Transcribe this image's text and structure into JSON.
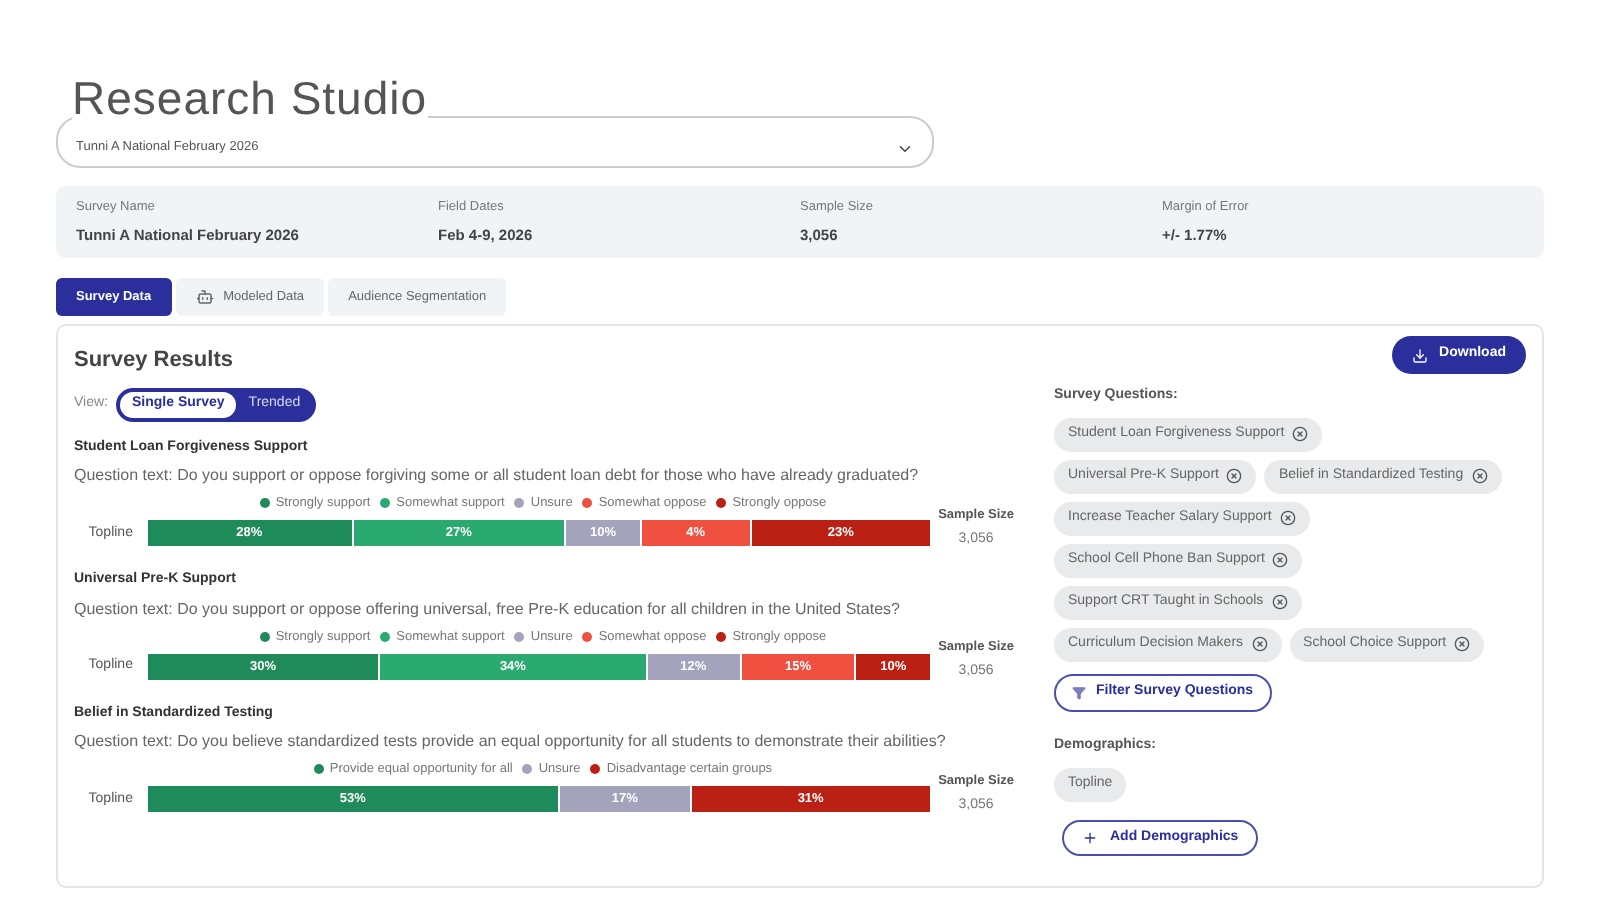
{
  "app_title": "Research Studio",
  "survey_select": {
    "value": "Tunni A National February 2026"
  },
  "summary": [
    {
      "label": "Survey Name",
      "value": "Tunni A National February 2026"
    },
    {
      "label": "Field Dates",
      "value": "Feb 4-9, 2026"
    },
    {
      "label": "Sample Size",
      "value": "3,056"
    },
    {
      "label": "Margin of Error",
      "value": "+/- 1.77%"
    }
  ],
  "tabs": [
    {
      "label": "Survey Data",
      "selected": true,
      "icon": false
    },
    {
      "label": "Modeled Data",
      "selected": false,
      "icon": true
    },
    {
      "label": "Audience Segmentation",
      "selected": false,
      "icon": false
    }
  ],
  "results": {
    "title": "Survey Results",
    "view_label": "View:",
    "view_options": [
      {
        "label": "Single Survey",
        "selected": true
      },
      {
        "label": "Trended",
        "selected": false
      }
    ],
    "questions": [
      {
        "title": "Student Loan Forgiveness Support",
        "text": "Question text: Do you support or oppose forgiving some or all student loan debt for those who have already graduated?",
        "row_label": "Topline",
        "sample_label": "Sample Size",
        "sample_value": "3,056",
        "legend": [
          {
            "label": "Strongly support",
            "color": "#1f8a5a"
          },
          {
            "label": "Somewhat support",
            "color": "#2aaa6e"
          },
          {
            "label": "Unsure",
            "color": "#a3a3bb"
          },
          {
            "label": "Somewhat oppose",
            "color": "#ef5040"
          },
          {
            "label": "Strongly oppose",
            "color": "#bb2015"
          }
        ],
        "segments": [
          {
            "label": "28%",
            "color": "#1f8a5a"
          },
          {
            "label": "27%",
            "color": "#2aaa6e"
          },
          {
            "label": "10%",
            "color": "#a3a3bb"
          },
          {
            "label": "4%",
            "color": "#ef5040"
          },
          {
            "label": "23%",
            "color": "#bb2015"
          }
        ]
      },
      {
        "title": "Universal Pre-K Support",
        "text": "Question text: Do you support or oppose offering universal, free Pre-K education for all children in the United States?",
        "row_label": "Topline",
        "sample_label": "Sample Size",
        "sample_value": "3,056",
        "legend": [
          {
            "label": "Strongly support",
            "color": "#1f8a5a"
          },
          {
            "label": "Somewhat support",
            "color": "#2aaa6e"
          },
          {
            "label": "Unsure",
            "color": "#a3a3bb"
          },
          {
            "label": "Somewhat oppose",
            "color": "#ef5040"
          },
          {
            "label": "Strongly oppose",
            "color": "#bb2015"
          }
        ],
        "segments": [
          {
            "label": "30%",
            "color": "#1f8a5a"
          },
          {
            "label": "34%",
            "color": "#2aaa6e"
          },
          {
            "label": "12%",
            "color": "#a3a3bb"
          },
          {
            "label": "15%",
            "color": "#ef5040"
          },
          {
            "label": "10%",
            "color": "#bb2015"
          }
        ]
      },
      {
        "title": "Belief in Standardized Testing",
        "text": "Question text: Do you believe standardized tests provide an equal opportunity for all students to demonstrate their abilities?",
        "row_label": "Topline",
        "sample_label": "Sample Size",
        "sample_value": "3,056",
        "legend": [
          {
            "label": "Provide equal opportunity for all",
            "color": "#1f8a5a"
          },
          {
            "label": "Unsure",
            "color": "#a3a3bb"
          },
          {
            "label": "Disadvantage certain groups",
            "color": "#bb2015"
          }
        ],
        "segments": [
          {
            "label": "53%",
            "color": "#1f8a5a"
          },
          {
            "label": "17%",
            "color": "#a3a3bb"
          },
          {
            "label": "31%",
            "color": "#bb2015"
          }
        ]
      }
    ]
  },
  "sidebar": {
    "download": "Download",
    "questions_title": "Survey Questions:",
    "question_chips": [
      [
        "Student Loan Forgiveness Support"
      ],
      [
        "Universal Pre-K Support",
        "Belief in Standardized Testing"
      ],
      [
        "Increase Teacher Salary Support"
      ],
      [
        "School Cell Phone Ban Support"
      ],
      [
        "Support CRT Taught in Schools"
      ],
      [
        "Curriculum Decision Makers",
        "School Choice Support"
      ]
    ],
    "filter_button": "Filter Survey Questions",
    "demographics_title": "Demographics:",
    "demographic_chips": [
      "Topline"
    ],
    "add_button": "Add Demographics"
  }
}
